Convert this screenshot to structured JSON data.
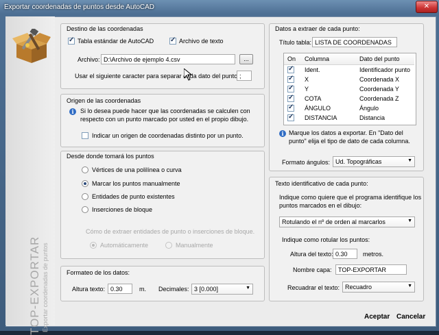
{
  "window": {
    "title": "Exportar coordenadas de puntos desde AutoCAD",
    "close": "✕"
  },
  "sidebar": {
    "product": "TOP-EXPORTAR",
    "subtitle": "Exportar coordenadas de puntos"
  },
  "destino": {
    "legend": "Destino de las coordenadas",
    "tabla_label": "Tabla estándar de AutoCAD",
    "tabla_checked": true,
    "archivo_label": "Archivo de texto",
    "archivo_checked": true,
    "file_label": "Archivo:",
    "file_value": "D:\\Archivo de ejemplo 4.csv",
    "browse_label": "...",
    "sep_label": "Usar el siguiente caracter para separar cada dato del punto:",
    "sep_value": ";"
  },
  "origen": {
    "legend": "Origen de las coordenadas",
    "info_line1": "Si lo desea puede hacer que las coordenadas se calculen con",
    "info_line2": "respecto con un punto marcado por usted en el propio dibujo.",
    "check_label": "Indicar un origen de coordenadas distinto por un punto.",
    "checked": false
  },
  "desde": {
    "legend": "Desde donde tomará los puntos",
    "options": [
      {
        "label": "Vértices de una polilínea o curva",
        "selected": false
      },
      {
        "label": "Marcar los puntos manualmente",
        "selected": true
      },
      {
        "label": "Entidades de punto existentes",
        "selected": false
      },
      {
        "label": "Inserciones de bloque",
        "selected": false
      }
    ],
    "extract_label": "Cómo de extraer entidades de punto o inserciones de bloque.",
    "auto_label": "Automáticamente",
    "manual_label": "Manualmente"
  },
  "formateo": {
    "legend": "Formateo de los datos:",
    "altura_label": "Altura texto:",
    "altura_value": "0.30",
    "altura_unit": "m.",
    "dec_label": "Decimales:",
    "dec_value": "3 [0.000]"
  },
  "datos": {
    "legend": "Datos a extraer de cada punto:",
    "titulo_label": "Título tabla:",
    "titulo_value": "LISTA DE COORDENADAS",
    "col_on": "On",
    "col_columna": "Columna",
    "col_dato": "Dato del punto",
    "rows": [
      {
        "col": "Ident.",
        "dato": "Identificador punto",
        "on": true
      },
      {
        "col": "X",
        "dato": "Coordenada X",
        "on": true
      },
      {
        "col": "Y",
        "dato": "Coordenada Y",
        "on": true
      },
      {
        "col": "COTA",
        "dato": "Coordenada Z",
        "on": true
      },
      {
        "col": "ÁNGULO",
        "dato": "Ángulo",
        "on": true
      },
      {
        "col": "DISTANCIA",
        "dato": "Distancia",
        "on": true
      }
    ],
    "info_line1": "Marque los datos a exportar. En \"Dato del",
    "info_line2": "punto\" elija el tipo de dato de cada columna.",
    "angulos_label": "Formato ángulos:",
    "angulos_value": "Ud. Topográficas"
  },
  "texto": {
    "legend": "Texto identificativo de cada punto:",
    "info_line1": "Indique como quiere que el programa identifique los",
    "info_line2": "puntos marcados en el dibujo:",
    "rotulo_value": "Rotulando el nº de orden al marcarlos",
    "como_label": "Indique como rotular los puntos:",
    "altura_label": "Altura del texto:",
    "altura_value": "0.30",
    "altura_unit": "metros.",
    "capa_label": "Nombre capa:",
    "capa_value": "TOP-EXPORTAR",
    "recuadrar_label": "Recuadrar el texto:",
    "recuadrar_value": "Recuadro"
  },
  "footer": {
    "accept": "Aceptar",
    "cancel": "Cancelar"
  }
}
